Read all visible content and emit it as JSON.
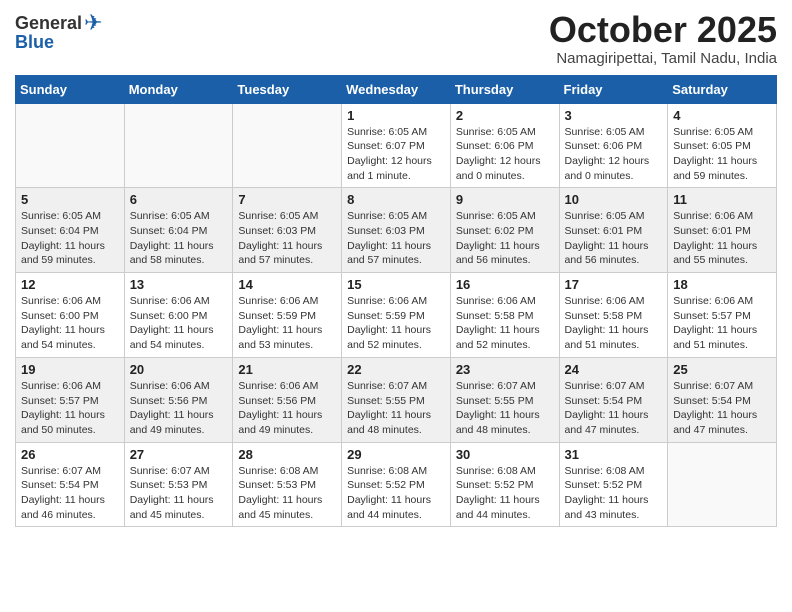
{
  "logo": {
    "general": "General",
    "blue": "Blue"
  },
  "header": {
    "month": "October 2025",
    "location": "Namagiripettai, Tamil Nadu, India"
  },
  "weekdays": [
    "Sunday",
    "Monday",
    "Tuesday",
    "Wednesday",
    "Thursday",
    "Friday",
    "Saturday"
  ],
  "weeks": [
    [
      {
        "day": "",
        "text": ""
      },
      {
        "day": "",
        "text": ""
      },
      {
        "day": "",
        "text": ""
      },
      {
        "day": "1",
        "text": "Sunrise: 6:05 AM\nSunset: 6:07 PM\nDaylight: 12 hours\nand 1 minute."
      },
      {
        "day": "2",
        "text": "Sunrise: 6:05 AM\nSunset: 6:06 PM\nDaylight: 12 hours\nand 0 minutes."
      },
      {
        "day": "3",
        "text": "Sunrise: 6:05 AM\nSunset: 6:06 PM\nDaylight: 12 hours\nand 0 minutes."
      },
      {
        "day": "4",
        "text": "Sunrise: 6:05 AM\nSunset: 6:05 PM\nDaylight: 11 hours\nand 59 minutes."
      }
    ],
    [
      {
        "day": "5",
        "text": "Sunrise: 6:05 AM\nSunset: 6:04 PM\nDaylight: 11 hours\nand 59 minutes."
      },
      {
        "day": "6",
        "text": "Sunrise: 6:05 AM\nSunset: 6:04 PM\nDaylight: 11 hours\nand 58 minutes."
      },
      {
        "day": "7",
        "text": "Sunrise: 6:05 AM\nSunset: 6:03 PM\nDaylight: 11 hours\nand 57 minutes."
      },
      {
        "day": "8",
        "text": "Sunrise: 6:05 AM\nSunset: 6:03 PM\nDaylight: 11 hours\nand 57 minutes."
      },
      {
        "day": "9",
        "text": "Sunrise: 6:05 AM\nSunset: 6:02 PM\nDaylight: 11 hours\nand 56 minutes."
      },
      {
        "day": "10",
        "text": "Sunrise: 6:05 AM\nSunset: 6:01 PM\nDaylight: 11 hours\nand 56 minutes."
      },
      {
        "day": "11",
        "text": "Sunrise: 6:06 AM\nSunset: 6:01 PM\nDaylight: 11 hours\nand 55 minutes."
      }
    ],
    [
      {
        "day": "12",
        "text": "Sunrise: 6:06 AM\nSunset: 6:00 PM\nDaylight: 11 hours\nand 54 minutes."
      },
      {
        "day": "13",
        "text": "Sunrise: 6:06 AM\nSunset: 6:00 PM\nDaylight: 11 hours\nand 54 minutes."
      },
      {
        "day": "14",
        "text": "Sunrise: 6:06 AM\nSunset: 5:59 PM\nDaylight: 11 hours\nand 53 minutes."
      },
      {
        "day": "15",
        "text": "Sunrise: 6:06 AM\nSunset: 5:59 PM\nDaylight: 11 hours\nand 52 minutes."
      },
      {
        "day": "16",
        "text": "Sunrise: 6:06 AM\nSunset: 5:58 PM\nDaylight: 11 hours\nand 52 minutes."
      },
      {
        "day": "17",
        "text": "Sunrise: 6:06 AM\nSunset: 5:58 PM\nDaylight: 11 hours\nand 51 minutes."
      },
      {
        "day": "18",
        "text": "Sunrise: 6:06 AM\nSunset: 5:57 PM\nDaylight: 11 hours\nand 51 minutes."
      }
    ],
    [
      {
        "day": "19",
        "text": "Sunrise: 6:06 AM\nSunset: 5:57 PM\nDaylight: 11 hours\nand 50 minutes."
      },
      {
        "day": "20",
        "text": "Sunrise: 6:06 AM\nSunset: 5:56 PM\nDaylight: 11 hours\nand 49 minutes."
      },
      {
        "day": "21",
        "text": "Sunrise: 6:06 AM\nSunset: 5:56 PM\nDaylight: 11 hours\nand 49 minutes."
      },
      {
        "day": "22",
        "text": "Sunrise: 6:07 AM\nSunset: 5:55 PM\nDaylight: 11 hours\nand 48 minutes."
      },
      {
        "day": "23",
        "text": "Sunrise: 6:07 AM\nSunset: 5:55 PM\nDaylight: 11 hours\nand 48 minutes."
      },
      {
        "day": "24",
        "text": "Sunrise: 6:07 AM\nSunset: 5:54 PM\nDaylight: 11 hours\nand 47 minutes."
      },
      {
        "day": "25",
        "text": "Sunrise: 6:07 AM\nSunset: 5:54 PM\nDaylight: 11 hours\nand 47 minutes."
      }
    ],
    [
      {
        "day": "26",
        "text": "Sunrise: 6:07 AM\nSunset: 5:54 PM\nDaylight: 11 hours\nand 46 minutes."
      },
      {
        "day": "27",
        "text": "Sunrise: 6:07 AM\nSunset: 5:53 PM\nDaylight: 11 hours\nand 45 minutes."
      },
      {
        "day": "28",
        "text": "Sunrise: 6:08 AM\nSunset: 5:53 PM\nDaylight: 11 hours\nand 45 minutes."
      },
      {
        "day": "29",
        "text": "Sunrise: 6:08 AM\nSunset: 5:52 PM\nDaylight: 11 hours\nand 44 minutes."
      },
      {
        "day": "30",
        "text": "Sunrise: 6:08 AM\nSunset: 5:52 PM\nDaylight: 11 hours\nand 44 minutes."
      },
      {
        "day": "31",
        "text": "Sunrise: 6:08 AM\nSunset: 5:52 PM\nDaylight: 11 hours\nand 43 minutes."
      },
      {
        "day": "",
        "text": ""
      }
    ]
  ]
}
